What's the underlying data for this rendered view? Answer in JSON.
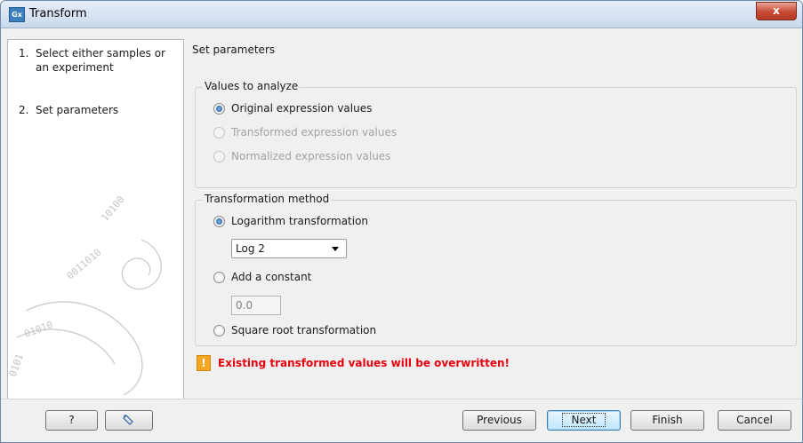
{
  "window": {
    "app_icon": "Gx",
    "title": "Transform",
    "close_glyph": "x"
  },
  "sidebar": {
    "steps": [
      {
        "number": "1.",
        "label": "Select either samples or an experiment"
      },
      {
        "number": "2.",
        "label": "Set parameters"
      }
    ]
  },
  "content": {
    "title": "Set parameters",
    "values_group": {
      "title": "Values to analyze",
      "options": [
        {
          "label": "Original expression values",
          "selected": true,
          "enabled": true
        },
        {
          "label": "Transformed expression values",
          "selected": false,
          "enabled": false
        },
        {
          "label": "Normalized expression values",
          "selected": false,
          "enabled": false
        }
      ]
    },
    "method_group": {
      "title": "Transformation method",
      "log_label": "Logarithm transformation",
      "log_selected": true,
      "log_dropdown_value": "Log 2",
      "constant_label": "Add a constant",
      "constant_value": "0.0",
      "sqrt_label": "Square root transformation"
    },
    "warning": {
      "icon": "!",
      "text": "Existing transformed values will be overwritten!"
    }
  },
  "buttons": {
    "help": "?",
    "reset_icon": "reset-icon",
    "previous": "Previous",
    "next": "Next",
    "finish": "Finish",
    "cancel": "Cancel"
  },
  "colors": {
    "warning_text": "#e8000f",
    "warning_icon": "#f5a623",
    "titlebar": "#c9d9ec",
    "close_button": "#c74a35"
  }
}
